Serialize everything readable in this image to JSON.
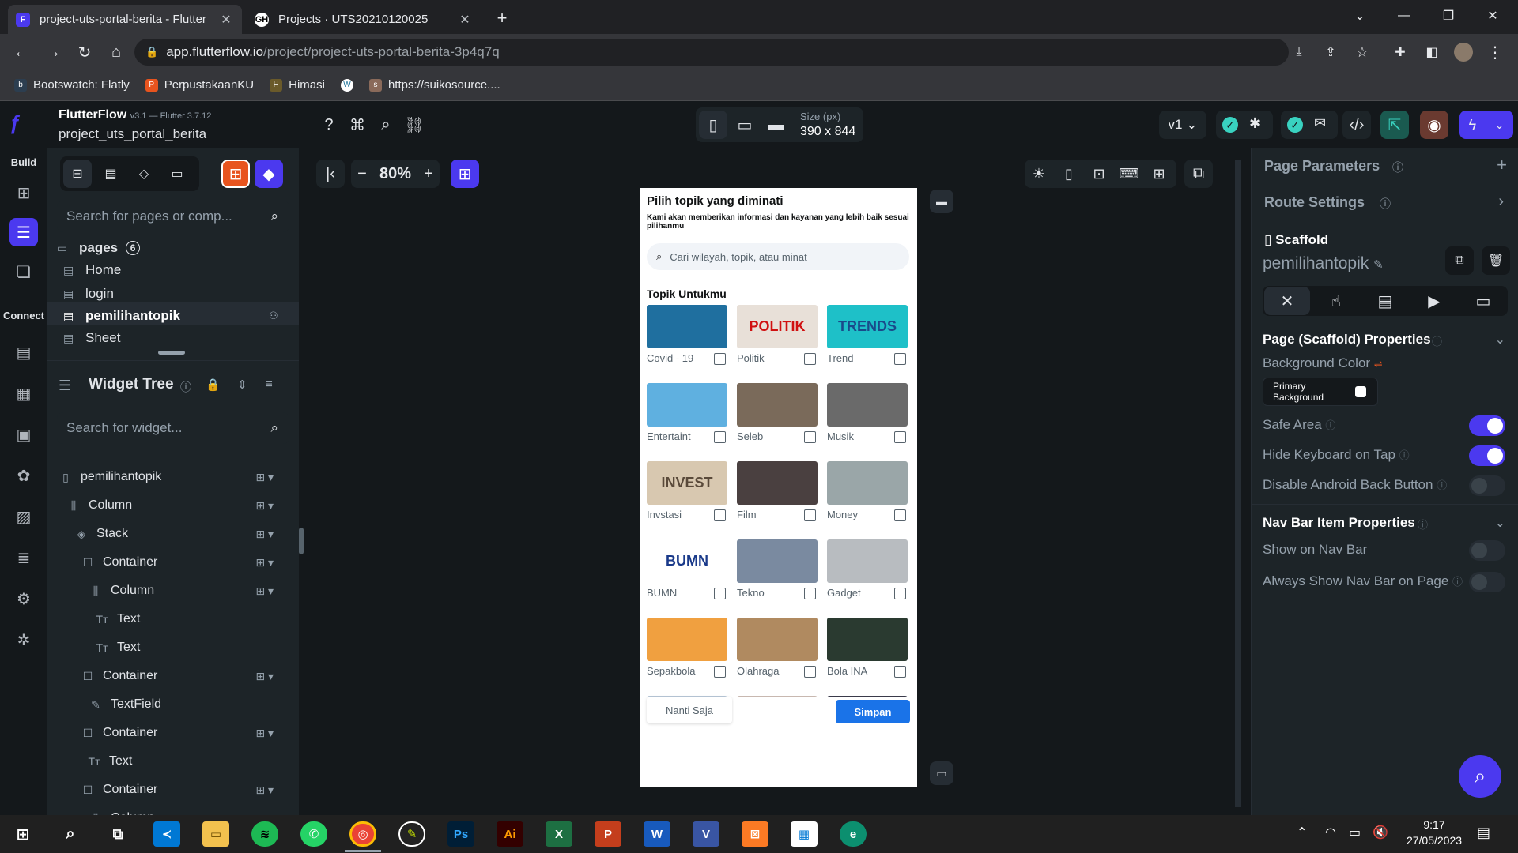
{
  "browser": {
    "tabs": [
      {
        "title": "project-uts-portal-berita - Flutter",
        "fav": "F"
      },
      {
        "title": "Projects · UTS20210120025",
        "fav": "GH"
      }
    ],
    "url_host": "app.flutterflow.io",
    "url_path": "/project/project-uts-portal-berita-3p4q7q",
    "bookmarks": [
      "Bootswatch: Flatly",
      "PerpustakaanKU",
      "Himasi",
      "https://suikosource...."
    ]
  },
  "ff": {
    "brand": "FlutterFlow",
    "version": "v3.1 — Flutter 3.7.12",
    "project": "project_uts_portal_berita",
    "zoom": "80%",
    "size_label": "Size (px)",
    "size_value": "390 x 844",
    "branch": "v1",
    "rail": {
      "build": "Build",
      "connect": "Connect"
    },
    "pages_search": "Search for pages or comp...",
    "pages_label": "pages",
    "pages_count": "6",
    "pages": [
      "Home",
      "login",
      "pemilihantopik",
      "Sheet"
    ],
    "widget_tree_title": "Widget Tree",
    "widget_search": "Search for widget...",
    "tree": [
      {
        "name": "pemilihantopik",
        "icon": "▯"
      },
      {
        "name": "Column",
        "icon": "⫼"
      },
      {
        "name": "Stack",
        "icon": "◈"
      },
      {
        "name": "Container",
        "icon": "☐"
      },
      {
        "name": "Column",
        "icon": "⫼"
      },
      {
        "name": "Text",
        "icon": "Tт"
      },
      {
        "name": "Text",
        "icon": "Tт"
      },
      {
        "name": "Container",
        "icon": "☐"
      },
      {
        "name": "TextField",
        "icon": "✎"
      },
      {
        "name": "Container",
        "icon": "☐"
      },
      {
        "name": "Text",
        "icon": "Tт"
      },
      {
        "name": "Container",
        "icon": "☐"
      },
      {
        "name": "Column",
        "icon": "⫼"
      }
    ]
  },
  "device": {
    "title": "Pilih topik yang diminati",
    "subtitle": "Kami akan memberikan informasi dan kayanan yang lebih baik sesuai pilihanmu",
    "search_placeholder": "Cari wilayah, topik, atau minat",
    "section": "Topik Untukmu",
    "topics": [
      "Covid - 19",
      "Politik",
      "Trend",
      "Entertaint",
      "Seleb",
      "Musik",
      "Invstasi",
      "Film",
      "Money",
      "BUMN",
      "Tekno",
      "Gadget",
      "Sepakbola",
      "Olahraga",
      "Bola INA"
    ],
    "topic_colors": [
      "#1f6f9f",
      "#e8e0d8",
      "#1ec0c8",
      "#5fb0e0",
      "#7a6a5a",
      "#6a6a6a",
      "#d8c8b0",
      "#4a4040",
      "#9aa6a8",
      "#ffffff",
      "#7a8aa0",
      "#b8bcc0",
      "#f0a040",
      "#b08a60",
      "#2a3a30"
    ],
    "image_texts": {
      "politik": "POLITIK",
      "trend": "TRENDS",
      "invest": "INVEST",
      "bumn": "BUMN"
    },
    "btn_later": "Nanti Saja",
    "btn_save": "Simpan"
  },
  "right": {
    "page_params": "Page Parameters",
    "route_settings": "Route Settings",
    "scaffold": "Scaffold",
    "page_name": "pemilihantopik",
    "props_title": "Page (Scaffold) Properties",
    "bg_color_label": "Background Color",
    "bg_color_value": "Primary Background",
    "safe_area": "Safe Area",
    "hide_kb": "Hide Keyboard on Tap",
    "disable_back": "Disable Android Back Button",
    "navbar_title": "Nav Bar Item Properties",
    "show_nav": "Show on Nav Bar",
    "always_nav": "Always Show Nav Bar on Page"
  },
  "taskbar": {
    "time": "9:17",
    "date": "27/05/2023"
  },
  "colors": {
    "accent": "#4b39ef",
    "blue_btn": "#1a73e8"
  }
}
